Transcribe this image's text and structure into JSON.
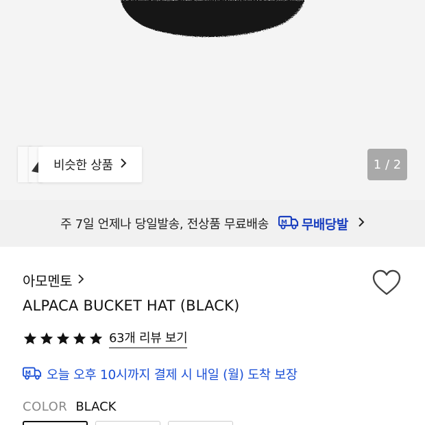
{
  "similar": {
    "label": "비슷한 상품"
  },
  "gallery": {
    "counter": "1 / 2"
  },
  "shipping": {
    "text": "주 7일 언제나 당일발송, 전상품 무료배송",
    "badge": "무배당발",
    "icon": "delivery-truck-icon"
  },
  "product": {
    "brand": "아모멘토",
    "name": "ALPACA BUCKET HAT (BLACK)",
    "rating": 5,
    "rating_max": 5,
    "review_link": "63개 리뷰 보기",
    "delivery": "오늘 오후 10시까지 결제 시 내일 (월) 도착 보장"
  },
  "color": {
    "label": "COLOR",
    "value": "BLACK"
  },
  "colors": {
    "accent_blue": "#1a4fd6",
    "badge_blue": "#1a3fbf",
    "counter_bg": "#a9a9a9"
  }
}
